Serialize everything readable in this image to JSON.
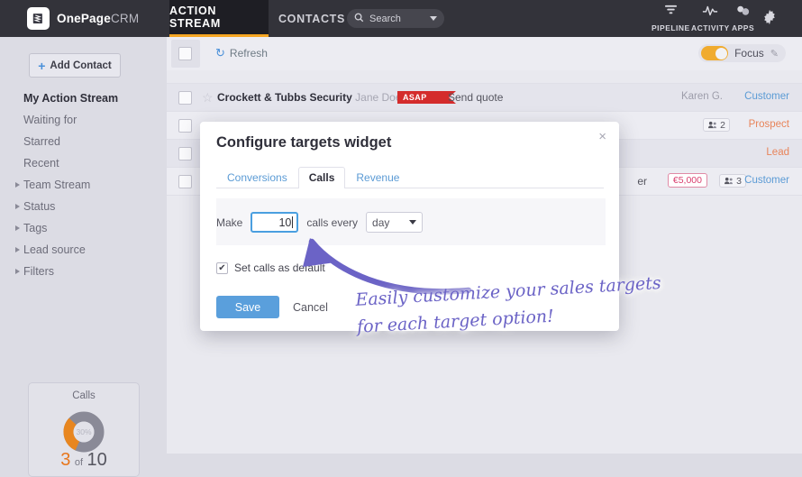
{
  "topbar": {
    "brand": "OnePage",
    "brand_suffix": "CRM",
    "logo_icon": "book-logo-icon",
    "tabs": [
      {
        "label": "ACTION STREAM",
        "active": true
      },
      {
        "label": "CONTACTS",
        "active": false
      }
    ],
    "search": {
      "placeholder": "Search",
      "icon": "search-icon",
      "caret": "chevron-down-icon"
    },
    "icons": [
      {
        "label": "PIPELINE",
        "icon": "funnel-icon"
      },
      {
        "label": "ACTIVITY",
        "icon": "pulse-icon"
      },
      {
        "label": "APPS",
        "icon": "puzzle-icon"
      },
      {
        "label": "",
        "icon": "gear-icon"
      }
    ]
  },
  "sidebar": {
    "add_contact": "Add Contact",
    "add_icon": "plus-icon",
    "items": [
      {
        "label": "My Action Stream",
        "bold": true,
        "expandable": false
      },
      {
        "label": "Waiting for",
        "bold": false,
        "expandable": false
      },
      {
        "label": "Starred",
        "bold": false,
        "expandable": false
      },
      {
        "label": "Recent",
        "bold": false,
        "expandable": false
      },
      {
        "label": "Team Stream",
        "bold": false,
        "expandable": true
      },
      {
        "label": "Status",
        "bold": false,
        "expandable": true
      },
      {
        "label": "Tags",
        "bold": false,
        "expandable": true
      },
      {
        "label": "Lead source",
        "bold": false,
        "expandable": true
      },
      {
        "label": "Filters",
        "bold": false,
        "expandable": true
      }
    ],
    "calls_widget": {
      "title": "Calls",
      "percent_label": "30%",
      "percent_value": 30,
      "current": "3",
      "of": "of",
      "total": "10",
      "ring_color": "#e8861f",
      "track_color": "#8a8a97"
    }
  },
  "toolbar": {
    "refresh_label": "Refresh",
    "refresh_icon": "refresh-icon",
    "select_all_icon": "checkbox-icon",
    "focus_label": "Focus",
    "focus_on": true,
    "focus_edit_icon": "pencil-icon",
    "toggle_color": "#f0ab2e"
  },
  "rows": [
    {
      "checkbox": "checkbox-icon",
      "star": "star-icon",
      "company": "Crockett & Tubbs Security",
      "person": "Jane Doe",
      "flag": "ASAP",
      "action": "Send quote",
      "owner": "Karen G.",
      "status": "Customer",
      "status_type": "customer",
      "deal": "",
      "people_count": ""
    },
    {
      "checkbox": "checkbox-icon",
      "star": "star-icon",
      "company": "",
      "person": "",
      "flag": "",
      "action": "",
      "owner": "",
      "status": "Prospect",
      "status_type": "prospect",
      "deal": "",
      "people_count": "2"
    },
    {
      "checkbox": "checkbox-icon",
      "star": "star-icon",
      "company": "",
      "person": "",
      "flag": "",
      "action": "",
      "owner": "",
      "status": "Lead",
      "status_type": "lead",
      "deal": "",
      "people_count": ""
    },
    {
      "checkbox": "checkbox-icon",
      "star": "star-icon",
      "company": "",
      "person": "",
      "flag": "",
      "action": "er",
      "owner": "",
      "status": "Customer",
      "status_type": "customer",
      "deal": "€5,000",
      "people_count": "3"
    }
  ],
  "modal": {
    "title": "Configure targets widget",
    "close_icon": "close-icon",
    "tabs": [
      {
        "label": "Conversions",
        "active": false
      },
      {
        "label": "Calls",
        "active": true
      },
      {
        "label": "Revenue",
        "active": false
      }
    ],
    "form": {
      "prefix_label": "Make",
      "amount_value": "10",
      "middle_label": "calls every",
      "period_value": "day",
      "period_caret": "chevron-down-icon"
    },
    "checkbox_label": "Set calls as default",
    "checkbox_checked": true,
    "checkbox_glyph": "✔",
    "save_label": "Save",
    "cancel_label": "Cancel",
    "save_color": "#5a9fdc"
  },
  "annotation": {
    "line1": "Easily customize your sales targets",
    "line2": "for each target option!",
    "color": "#6b63c6",
    "arrow_icon": "curved-arrow-icon"
  }
}
